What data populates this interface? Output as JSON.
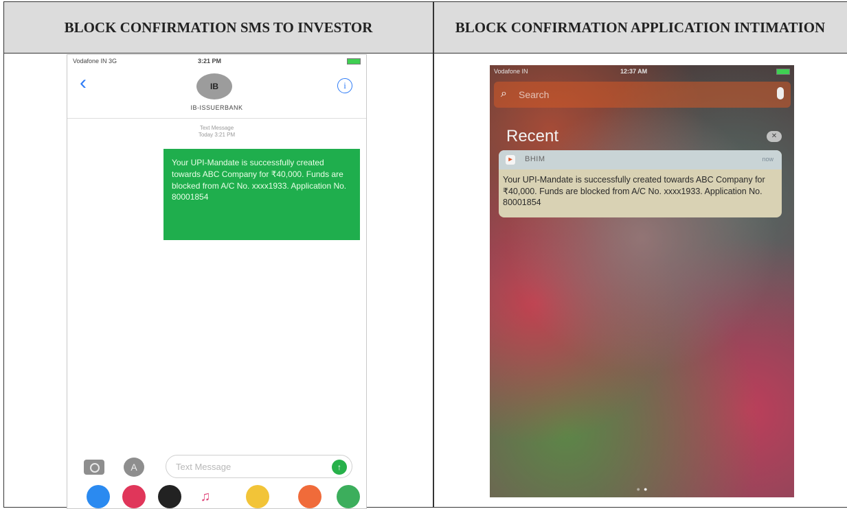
{
  "headers": {
    "left": "BLOCK CONFIRMATION SMS TO INVESTOR",
    "right": "BLOCK CONFIRMATION APPLICATION INTIMATION"
  },
  "sms_screen": {
    "status_bar": {
      "carrier": "Vodafone IN 3G",
      "time": "3:21 PM"
    },
    "avatar_initials": "IB",
    "sender_name": "IB-ISSUERBANK",
    "message_meta": {
      "type": "Text Message",
      "when": "Today 3:21 PM"
    },
    "message": "Your UPI-Mandate is successfully created towards ABC Company for ₹40,000. Funds are blocked from A/C No. xxxx1933. Application No. 80001854",
    "input_placeholder": "Text Message",
    "colors": {
      "bubble": "#1fae4d",
      "accent": "#2f7cf6"
    }
  },
  "notification_screen": {
    "status_bar": {
      "carrier": "Vodafone IN",
      "time": "12:37 AM"
    },
    "search_placeholder": "Search",
    "section_title": "Recent",
    "notification": {
      "app_name": "BHIM",
      "time": "now",
      "body": "Your UPI-Mandate is successfully created towards ABC Company for ₹40,000. Funds are blocked from A/C No. xxxx1933. Application No. 80001854"
    }
  }
}
